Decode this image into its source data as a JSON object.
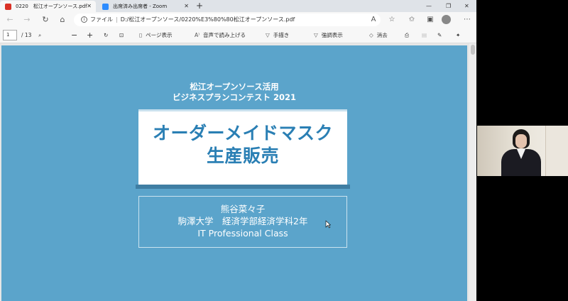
{
  "tabs": [
    {
      "label": "0220　松江オープンソース.pdf",
      "close": "✕"
    },
    {
      "label": "出席済み出席者 - Zoom",
      "close": "✕"
    }
  ],
  "new_tab": "+",
  "window_controls": {
    "minimize": "—",
    "restore": "❐",
    "close": "✕"
  },
  "address": {
    "scheme_label": "ファイル",
    "url": "D:/松江オープンソース/0220%E3%80%80松江オープンソース.pdf"
  },
  "pdf_toolbar": {
    "page_current": "1",
    "page_total": "/ 13",
    "page_view": "ページ表示",
    "read_aloud": "音声で読み上げる",
    "draw": "手描き",
    "highlight": "強調表示",
    "erase": "消去"
  },
  "slide": {
    "subtitle_line1": "松江オープンソース活用",
    "subtitle_line2": "ビジネスプランコンテスト 2021",
    "title_line1": "オーダーメイドマスク",
    "title_line2": "生産販売",
    "author": "熊谷菜々子",
    "affiliation": "駒澤大学　経済学部経済学科2年",
    "program": "IT Professional Class"
  },
  "colors": {
    "slide_bg": "#5ba4cb",
    "title_text": "#2a7fb4"
  }
}
